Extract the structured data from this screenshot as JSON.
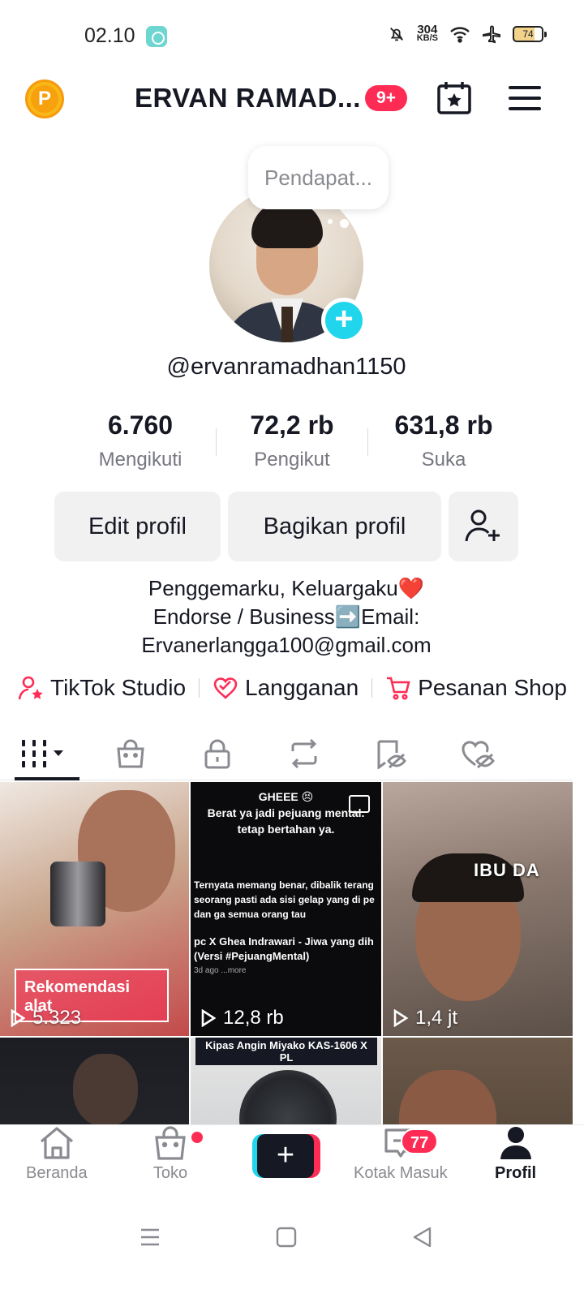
{
  "status_bar": {
    "time": "02.10",
    "network_speed_value": "304",
    "network_speed_unit": "KB/S",
    "battery": "74"
  },
  "header": {
    "title": "ERVAN RAMAD...",
    "notification_badge": "9+",
    "coin_letter": "P"
  },
  "profile": {
    "note_bubble": "Pendapat...",
    "handle": "@ervanramadhan1150",
    "stats": [
      {
        "value": "6.760",
        "label": "Mengikuti"
      },
      {
        "value": "72,2 rb",
        "label": "Pengikut"
      },
      {
        "value": "631,8 rb",
        "label": "Suka"
      }
    ],
    "edit_button": "Edit profil",
    "share_button": "Bagikan profil",
    "bio_lines": [
      "Penggemarku, Keluargaku❤️",
      "Endorse / Business➡️Email:",
      "Ervanerlangga100@gmail.com"
    ]
  },
  "links": [
    {
      "label": "TikTok Studio",
      "icon": "studio-icon"
    },
    {
      "label": "Langganan",
      "icon": "subscription-icon"
    },
    {
      "label": "Pesanan Shop",
      "icon": "cart-icon"
    }
  ],
  "tabs": [
    "videos",
    "shop",
    "private",
    "reposts",
    "favorites",
    "liked"
  ],
  "videos": [
    {
      "views": "5.323",
      "caption": "Rekomendasi alat"
    },
    {
      "views": "12,8 rb",
      "caption_title": "GHEEE 😣",
      "caption_line1": "Berat ya jadi pejuang mental.",
      "caption_line2": "tetap bertahan ya.",
      "caption_body": "Ternyata memang benar, dibalik terang seorang pasti ada sisi gelap yang di pe dan ga semua orang tau",
      "caption_song": "pc X Ghea Indrawari - Jiwa yang dih (Versi #PejuangMental)",
      "caption_meta": "3d ago ...more"
    },
    {
      "views": "1,4 jt",
      "caption": "IBU DA"
    },
    {
      "views": "",
      "caption": ""
    },
    {
      "views": "",
      "caption": "Kipas Angin Miyako KAS-1606 X PL"
    },
    {
      "views": "",
      "caption": ""
    }
  ],
  "bottom_nav": {
    "home": "Beranda",
    "shop": "Toko",
    "inbox": "Kotak Masuk",
    "inbox_badge": "77",
    "profile": "Profil"
  },
  "colors": {
    "accent_red": "#fe2c55",
    "accent_cyan": "#20d5ec",
    "text_primary": "#161823",
    "text_secondary": "#757680"
  }
}
